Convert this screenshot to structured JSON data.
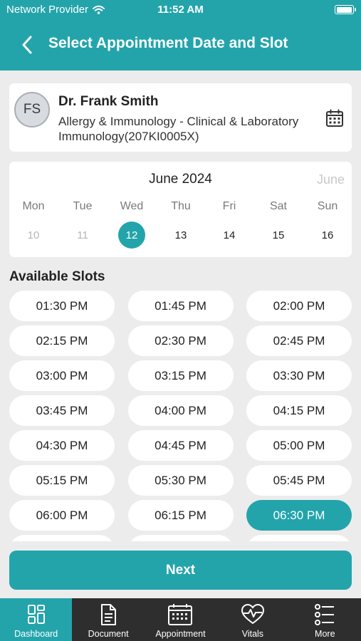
{
  "status_bar": {
    "carrier": "Network Provider",
    "time": "11:52 AM",
    "battery_level": 1.0
  },
  "header": {
    "title": "Select Appointment Date and Slot",
    "back_icon": "chevron-left-icon"
  },
  "doctor": {
    "initials": "FS",
    "name": "Dr. Frank Smith",
    "specialty": "Allergy & Immunology - Clinical & Laboratory Immunology(207KI0005X)",
    "calendar_icon": "calendar-icon"
  },
  "calendar": {
    "month": "June 2024",
    "next_month_peek": "June",
    "weekdays": [
      "Mon",
      "Tue",
      "Wed",
      "Thu",
      "Fri",
      "Sat",
      "Sun"
    ],
    "days": [
      {
        "label": "10",
        "state": "disabled"
      },
      {
        "label": "11",
        "state": "disabled"
      },
      {
        "label": "12",
        "state": "selected"
      },
      {
        "label": "13",
        "state": "available"
      },
      {
        "label": "14",
        "state": "available"
      },
      {
        "label": "15",
        "state": "available"
      },
      {
        "label": "16",
        "state": "available"
      }
    ]
  },
  "slots": {
    "title": "Available Slots",
    "selected": "06:30 PM",
    "items": [
      "01:30 PM",
      "01:45 PM",
      "02:00 PM",
      "02:15 PM",
      "02:30 PM",
      "02:45 PM",
      "03:00 PM",
      "03:15 PM",
      "03:30 PM",
      "03:45 PM",
      "04:00 PM",
      "04:15 PM",
      "04:30 PM",
      "04:45 PM",
      "05:00 PM",
      "05:15 PM",
      "05:30 PM",
      "05:45 PM",
      "06:00 PM",
      "06:15 PM",
      "06:30 PM",
      "",
      "",
      ""
    ]
  },
  "next_button": {
    "label": "Next"
  },
  "tabs": [
    {
      "label": "Dashboard",
      "icon": "dashboard-icon",
      "active": true
    },
    {
      "label": "Document",
      "icon": "document-icon",
      "active": false
    },
    {
      "label": "Appointment",
      "icon": "appointment-calendar-icon",
      "active": false
    },
    {
      "label": "Vitals",
      "icon": "heart-pulse-icon",
      "active": false
    },
    {
      "label": "More",
      "icon": "more-list-icon",
      "active": false
    }
  ],
  "colors": {
    "accent": "#23a4ab",
    "background": "#ececec",
    "tabbar": "#2e2e2e"
  }
}
